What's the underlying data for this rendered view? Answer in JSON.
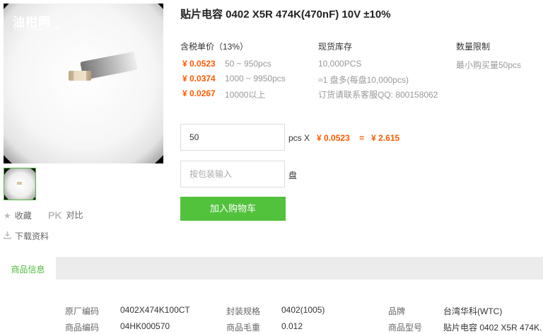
{
  "gallery": {
    "watermark": "油柑网",
    "watermark_sub": "YOUGANW.COM"
  },
  "actions": {
    "favorite": "收藏",
    "pk": "PK",
    "compare": "对比",
    "download": "下载资料"
  },
  "product": {
    "title": "贴片电容 0402 X5R 474K(470nF) 10V ±10%"
  },
  "pricing": {
    "col_price_header": "含税单价（13%）",
    "col_stock_header": "现货库存",
    "col_limit_header": "数量限制",
    "tiers": [
      {
        "price": "¥ 0.0523",
        "qty": "50 ~ 950pcs"
      },
      {
        "price": "¥ 0.0374",
        "qty": "1000 ~ 9950pcs"
      },
      {
        "price": "¥ 0.0267",
        "qty": "10000以上"
      }
    ],
    "stock": [
      "10,000PCS",
      "≈1 盘多(每盘10,000pcs)",
      "订货请联系客服QQ: 800158062"
    ],
    "limit": "最小购买量50pcs"
  },
  "order": {
    "quantity_value": "50",
    "unit": "pcs X",
    "unit_price": "¥ 0.0523",
    "equals": "=",
    "total": "¥ 2.615",
    "package_placeholder": "按包装输入",
    "package_unit": "盘",
    "add_to_cart": "加入购物车"
  },
  "tabs": {
    "product_info": "商品信息"
  },
  "specs": [
    {
      "k": "原厂编码",
      "v": "0402X474K100CT"
    },
    {
      "k": "封装规格",
      "v": "0402(1005)"
    },
    {
      "k": "品牌",
      "v": "台湾华科(WTC)"
    },
    {
      "k": "商品编码",
      "v": "04HK000570"
    },
    {
      "k": "商品毛重",
      "v": "0.012"
    },
    {
      "k": "商品型号",
      "v": "贴片电容 0402 X5R 474K."
    }
  ]
}
